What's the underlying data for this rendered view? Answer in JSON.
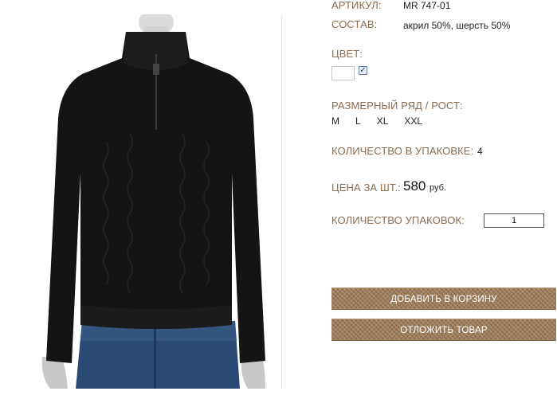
{
  "product": {
    "article_label": "АРТИКУЛ:",
    "article_value": "MR 747-01",
    "composition_label": "СОСТАВ:",
    "composition_value": "акрил 50%, шерсть 50%",
    "color_label": "ЦВЕТ:",
    "color_checkbox_mark": "✓",
    "size_label": "РАЗМЕРНЫЙ РЯД / РОСТ:",
    "sizes": [
      "M",
      "L",
      "XL",
      "XXL"
    ],
    "pack_qty_label": "КОЛИЧЕСТВО В УПАКОВКЕ:",
    "pack_qty_value": "4",
    "price_label": "ЦЕНА ЗА ШТ.:",
    "price_value": "580",
    "price_currency": "руб.",
    "packs_label": "КОЛИЧЕСТВО УПАКОВОК:",
    "packs_value": "1"
  },
  "actions": {
    "add_to_cart": "ДОБАВИТЬ В КОРЗИНУ",
    "postpone": "ОТЛОЖИТЬ ТОВАР"
  },
  "colors": {
    "label_brown": "#8b6a4e",
    "button_brown": "#9c7a55",
    "sweater": "#141414",
    "jeans": "#2b4a73"
  }
}
